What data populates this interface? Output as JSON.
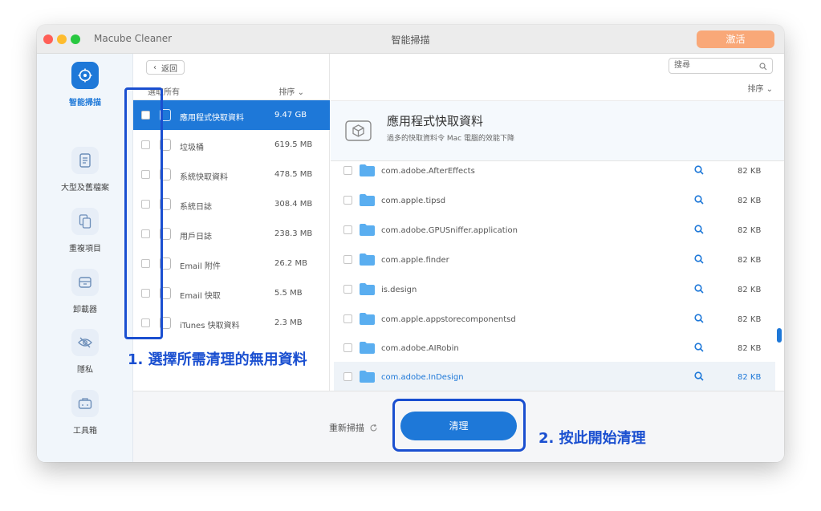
{
  "window": {
    "app_name": "Macube Cleaner",
    "title": "智能掃描",
    "activate_label": "激活"
  },
  "sidebar": {
    "items": [
      {
        "label": "智能掃描",
        "icon": "target-icon",
        "active": true
      },
      {
        "label": "大型及舊檔案",
        "icon": "document-icon",
        "active": false
      },
      {
        "label": "重複項目",
        "icon": "duplicate-icon",
        "active": false
      },
      {
        "label": "卸載器",
        "icon": "archive-box-icon",
        "active": false
      },
      {
        "label": "隱私",
        "icon": "eye-off-icon",
        "active": false
      },
      {
        "label": "工具箱",
        "icon": "toolbox-icon",
        "active": false
      }
    ]
  },
  "left_panel": {
    "back_label": "返回",
    "select_all_label": "選取所有",
    "sort_label": "排序",
    "categories": [
      {
        "name": "應用程式快取資料",
        "size": "9.47 GB",
        "selected": true
      },
      {
        "name": "垃圾桶",
        "size": "619.5 MB",
        "selected": false
      },
      {
        "name": "系統快取資料",
        "size": "478.5 MB",
        "selected": false
      },
      {
        "name": "系統日誌",
        "size": "308.4 MB",
        "selected": false
      },
      {
        "name": "用戶日誌",
        "size": "238.3 MB",
        "selected": false
      },
      {
        "name": "Email 附件",
        "size": "26.2 MB",
        "selected": false
      },
      {
        "name": "Email 快取",
        "size": "5.5 MB",
        "selected": false
      },
      {
        "name": "iTunes 快取資料",
        "size": "2.3 MB",
        "selected": false
      }
    ]
  },
  "search": {
    "placeholder": "搜尋"
  },
  "right_panel": {
    "sort_label": "排序",
    "title": "應用程式快取資料",
    "subtitle": "過多的快取資料令 Mac 電腦的效能下降",
    "files": [
      {
        "name": "com.adobe.AfterEffects",
        "size": "82 KB"
      },
      {
        "name": "com.apple.tipsd",
        "size": "82 KB"
      },
      {
        "name": "com.adobe.GPUSniffer.application",
        "size": "82 KB"
      },
      {
        "name": "com.apple.finder",
        "size": "82 KB"
      },
      {
        "name": "is.design",
        "size": "82 KB"
      },
      {
        "name": "com.apple.appstorecomponentsd",
        "size": "82 KB"
      },
      {
        "name": "com.adobe.AIRobin",
        "size": "82 KB"
      },
      {
        "name": "com.adobe.InDesign",
        "size": "82 KB",
        "highlighted": true
      }
    ]
  },
  "bottom": {
    "rescan_label": "重新掃描",
    "clean_label": "清理"
  },
  "annotations": {
    "step1": "1. 選擇所需清理的無用資料",
    "step2": "2. 按此開始清理"
  },
  "colors": {
    "accent": "#1e78d8",
    "activate": "#f9a878",
    "annotation": "#1a4fd0"
  }
}
